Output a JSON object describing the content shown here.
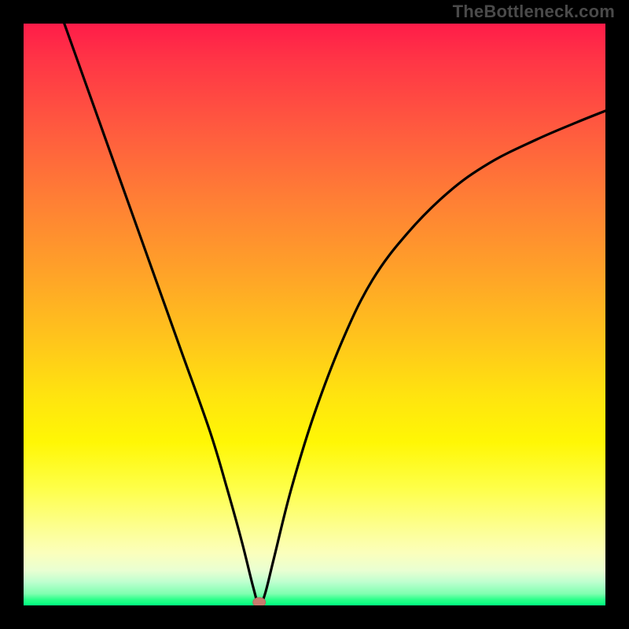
{
  "watermark": "TheBottleneck.com",
  "chart_data": {
    "type": "line",
    "title": "",
    "xlabel": "",
    "ylabel": "",
    "xlim": [
      0,
      100
    ],
    "ylim": [
      0,
      100
    ],
    "optimal": {
      "x": 40.5,
      "y": 0
    },
    "series": [
      {
        "name": "bottleneck-curve",
        "x": [
          7,
          12,
          17,
          22,
          27,
          32,
          35,
          37.5,
          39.5,
          40.5,
          41.5,
          43,
          46,
          50,
          55,
          60,
          66,
          73,
          80,
          88,
          95,
          100
        ],
        "values": [
          100,
          86,
          72,
          58,
          44,
          30,
          20,
          11,
          3,
          0,
          2,
          8,
          20,
          33,
          46,
          56,
          64,
          71,
          76,
          80,
          83,
          85
        ]
      }
    ],
    "gradient_stops": [
      {
        "pos": 0,
        "color": "#ff1c49"
      },
      {
        "pos": 42,
        "color": "#ffa029"
      },
      {
        "pos": 72,
        "color": "#fff705"
      },
      {
        "pos": 100,
        "color": "#00ff80"
      }
    ]
  }
}
